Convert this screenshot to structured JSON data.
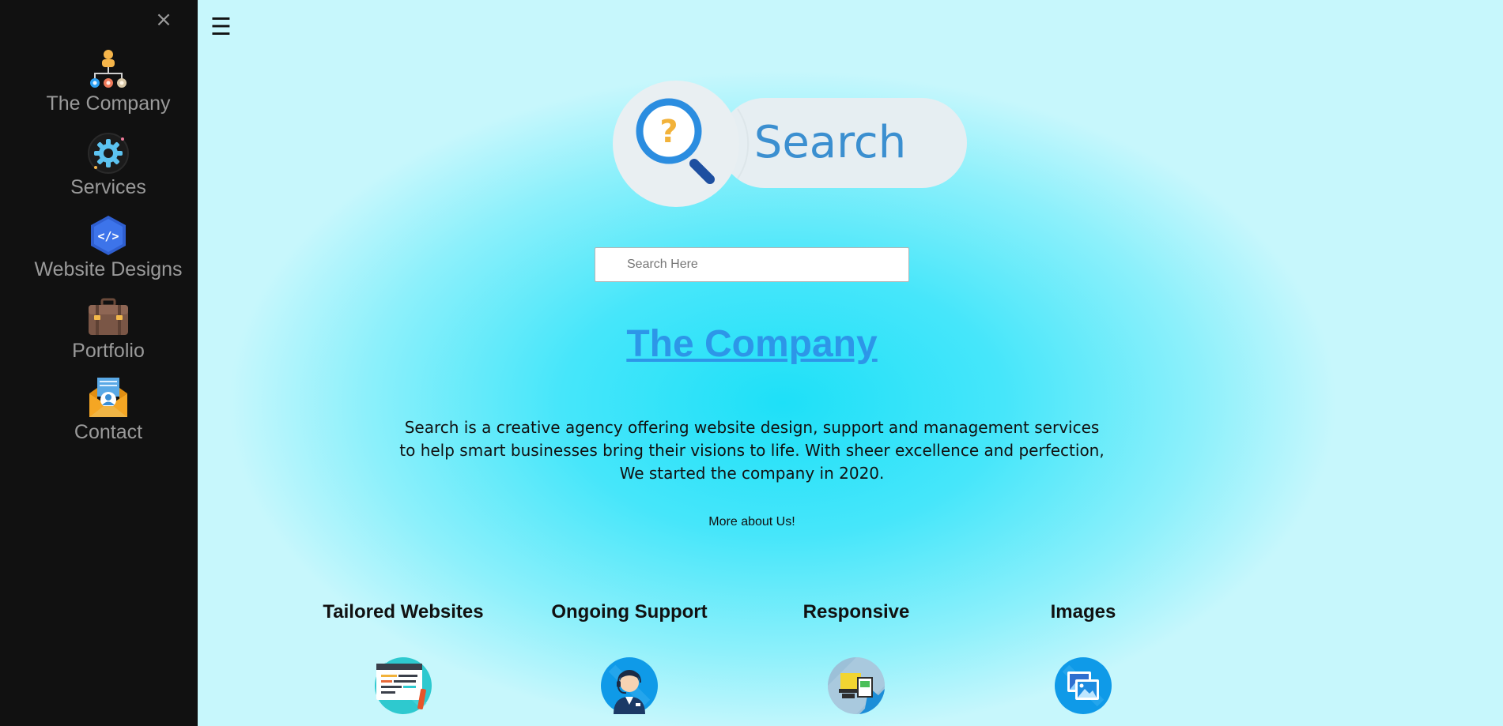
{
  "sidebar": {
    "close_symbol": "×",
    "items": [
      {
        "label": "The Company",
        "icon": "org-chart-icon"
      },
      {
        "label": "Services",
        "icon": "gear-icon"
      },
      {
        "label": "Website Designs",
        "icon": "code-hexagon-icon"
      },
      {
        "label": "Portfolio",
        "icon": "briefcase-icon"
      },
      {
        "label": "Contact",
        "icon": "envelope-contact-icon"
      }
    ]
  },
  "header": {
    "menu_symbol": "☰",
    "logo_text": "Search"
  },
  "search": {
    "placeholder": "Search Here",
    "value": ""
  },
  "main": {
    "title": "The Company",
    "description_lines": [
      "Search is a creative agency offering website design, support and management services",
      "to help smart businesses bring their visions to life. With sheer excellence and perfection,",
      "We started the company in 2020."
    ],
    "more_link": "More about Us!"
  },
  "features": [
    {
      "title": "Tailored Websites",
      "icon": "web-layout-icon"
    },
    {
      "title": "Ongoing Support",
      "icon": "support-agent-icon"
    },
    {
      "title": "Responsive",
      "icon": "responsive-devices-icon"
    },
    {
      "title": "Images",
      "icon": "images-icon"
    }
  ],
  "colors": {
    "sidebar_bg": "#111111",
    "sidebar_text": "#9a9a9a",
    "accent": "#2d96e8",
    "background_center": "#1ee0f8",
    "background_edge": "#c7f7fc"
  }
}
